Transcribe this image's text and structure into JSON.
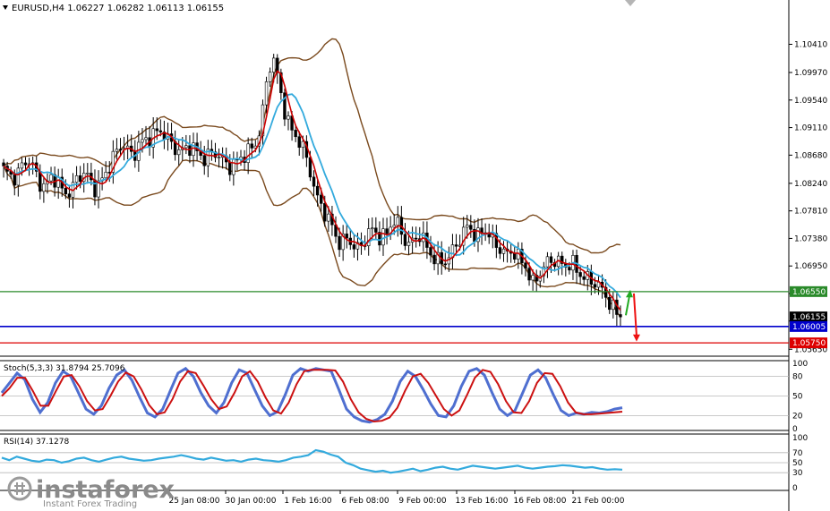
{
  "header": {
    "symbol_line": "EURUSD,H4  1.06227 1.06282 1.06113 1.06155",
    "stoch_label": "Stoch(5,3,3) 31.8794 25.7096",
    "rsi_label": "RSI(14) 37.1278"
  },
  "watermark": {
    "brand": "instaforex",
    "tagline": "Instant Forex Trading"
  },
  "colors": {
    "green_level": "#2a8a2a",
    "blue_level": "#0000cc",
    "red_level": "#dd0000",
    "bollinger": "#7a4a1e",
    "ma_fast": "#cc0000",
    "ma_slow": "#33aadd",
    "stoch_main": "#4f6fd0",
    "stoch_signal": "#cc1111",
    "rsi_line": "#33aadd",
    "up_arrow": "#22aa22",
    "down_arrow": "#ee1111"
  },
  "chart_data": [
    {
      "type": "candlestick",
      "title": "EURUSD,H4",
      "ohlc_last": {
        "open": 1.06227,
        "high": 1.06282,
        "low": 1.06113,
        "close": 1.06155
      },
      "y_ticks": [
        "1.10410",
        "1.09970",
        "1.09540",
        "1.09110",
        "1.08680",
        "1.08240",
        "1.07810",
        "1.07380",
        "1.06950",
        "1.06520",
        "1.06090",
        "1.05650"
      ],
      "ylim": [
        1.0557,
        1.1085
      ],
      "x_ticks": [
        "25 Jan 08:00",
        "30 Jan 00:00",
        "1 Feb 16:00",
        "6 Feb 08:00",
        "9 Feb 00:00",
        "13 Feb 16:00",
        "16 Feb 08:00",
        "21 Feb 00:00"
      ],
      "price_path": [
        1.0845,
        1.0838,
        1.0832,
        1.084,
        1.0855,
        1.0862,
        1.085,
        1.083,
        1.0818,
        1.0825,
        1.0836,
        1.0828,
        1.0812,
        1.0808,
        1.0815,
        1.0832,
        1.084,
        1.0838,
        1.0822,
        1.0815,
        1.0828,
        1.0842,
        1.086,
        1.0872,
        1.0885,
        1.088,
        1.0868,
        1.0874,
        1.0888,
        1.0892,
        1.0895,
        1.0902,
        1.0908,
        1.0898,
        1.0888,
        1.088,
        1.0872,
        1.0878,
        1.0882,
        1.0876,
        1.087,
        1.0862,
        1.0868,
        1.0874,
        1.0866,
        1.0858,
        1.085,
        1.0854,
        1.086,
        1.0868,
        1.0874,
        1.088,
        1.0895,
        1.094,
        1.1,
        1.102,
        1.099,
        1.095,
        1.092,
        1.0905,
        1.0895,
        1.088,
        1.0862,
        1.083,
        1.08,
        1.079,
        1.077,
        1.076,
        1.0738,
        1.0728,
        1.074,
        1.0732,
        1.072,
        1.0726,
        1.074,
        1.0752,
        1.0748,
        1.0738,
        1.0742,
        1.0758,
        1.0768,
        1.075,
        1.0735,
        1.0728,
        1.0736,
        1.0745,
        1.0732,
        1.0715,
        1.0708,
        1.07,
        1.0702,
        1.071,
        1.0722,
        1.0735,
        1.0748,
        1.076,
        1.0745,
        1.074,
        1.0752,
        1.0748,
        1.0732,
        1.0725,
        1.0718,
        1.0712,
        1.072,
        1.071,
        1.07,
        1.069,
        1.0665,
        1.0678,
        1.069,
        1.07,
        1.0705,
        1.0702,
        1.0698,
        1.0695,
        1.07,
        1.069,
        1.068,
        1.0675,
        1.0672,
        1.0668,
        1.066,
        1.065,
        1.0632,
        1.0625,
        1.0615
      ],
      "levels": [
        {
          "price": "1.06550",
          "color": "green"
        },
        {
          "price": "1.06155",
          "color": "black"
        },
        {
          "price": "1.06005",
          "color": "blue"
        },
        {
          "price": "1.05750",
          "color": "red"
        }
      ]
    },
    {
      "type": "line",
      "title": "Stoch(5,3,3)",
      "values_last": {
        "main": 31.8794,
        "signal": 25.7096
      },
      "y_ticks": [
        "100",
        "80",
        "50",
        "20",
        "0"
      ],
      "ylim": [
        0,
        100
      ],
      "levels": [
        80,
        50,
        20
      ],
      "main_path": [
        55,
        70,
        85,
        75,
        45,
        25,
        40,
        70,
        88,
        80,
        55,
        30,
        22,
        35,
        62,
        82,
        90,
        74,
        48,
        24,
        18,
        30,
        58,
        85,
        92,
        80,
        55,
        35,
        24,
        40,
        70,
        90,
        85,
        60,
        35,
        20,
        26,
        52,
        82,
        92,
        88,
        92,
        90,
        88,
        60,
        30,
        18,
        12,
        10,
        14,
        22,
        42,
        72,
        88,
        80,
        60,
        38,
        20,
        18,
        35,
        65,
        88,
        92,
        82,
        55,
        30,
        20,
        28,
        55,
        82,
        90,
        78,
        52,
        28,
        20,
        24,
        22,
        25,
        24,
        26,
        30,
        32
      ],
      "signal_path": [
        50,
        62,
        78,
        78,
        58,
        35,
        35,
        58,
        80,
        82,
        65,
        42,
        28,
        30,
        50,
        72,
        86,
        80,
        60,
        36,
        22,
        25,
        45,
        72,
        88,
        85,
        66,
        45,
        30,
        34,
        55,
        80,
        88,
        72,
        48,
        28,
        23,
        40,
        68,
        88,
        90,
        90,
        90,
        89,
        72,
        45,
        25,
        15,
        11,
        12,
        17,
        32,
        58,
        80,
        84,
        70,
        50,
        30,
        20,
        28,
        52,
        78,
        90,
        87,
        68,
        42,
        25,
        24,
        42,
        70,
        85,
        84,
        65,
        40,
        25,
        22,
        22,
        23,
        24,
        25,
        26
      ]
    },
    {
      "type": "line",
      "title": "RSI(14)",
      "value_last": 37.1278,
      "y_ticks": [
        "100",
        "70",
        "50",
        "30",
        "0"
      ],
      "ylim": [
        0,
        100
      ],
      "levels": [
        70,
        50,
        30
      ],
      "rsi_path": [
        60,
        55,
        62,
        58,
        54,
        52,
        56,
        55,
        50,
        53,
        58,
        60,
        55,
        52,
        56,
        60,
        62,
        58,
        56,
        54,
        55,
        58,
        60,
        62,
        65,
        62,
        58,
        56,
        60,
        57,
        54,
        55,
        52,
        56,
        58,
        55,
        54,
        52,
        55,
        60,
        62,
        65,
        75,
        72,
        66,
        62,
        50,
        45,
        38,
        35,
        32,
        34,
        30,
        32,
        35,
        38,
        33,
        36,
        40,
        42,
        38,
        36,
        40,
        44,
        42,
        40,
        38,
        40,
        42,
        44,
        40,
        38,
        40,
        42,
        43,
        45,
        44,
        42,
        40,
        41,
        38,
        36,
        37,
        36
      ]
    }
  ]
}
